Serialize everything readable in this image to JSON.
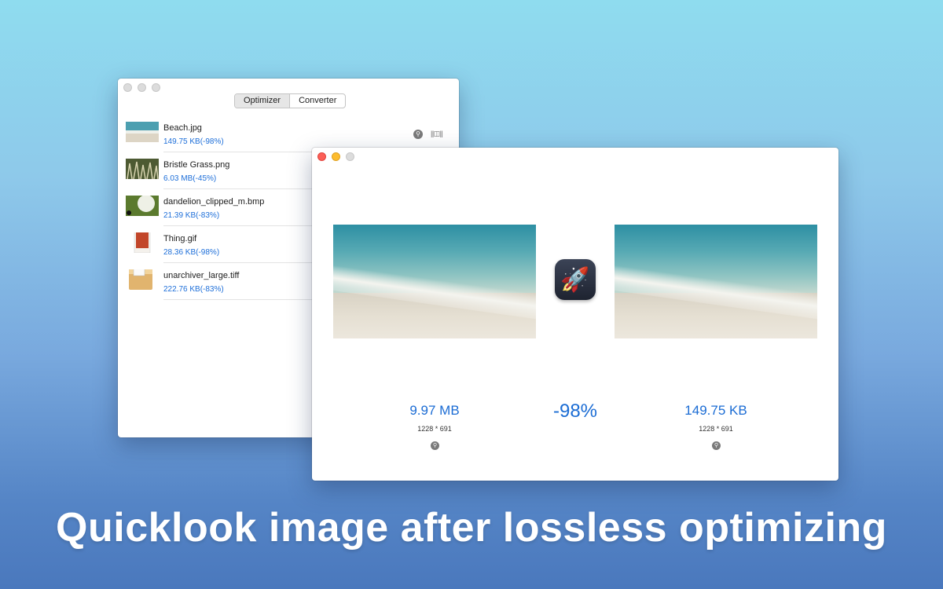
{
  "segmented": {
    "tabs": [
      "Optimizer",
      "Converter"
    ],
    "active": "Optimizer"
  },
  "files": [
    {
      "name": "Beach.jpg",
      "size": "149.75 KB(-98%)",
      "thumb": "beach"
    },
    {
      "name": "Bristle Grass.png",
      "size": "6.03 MB(-45%)",
      "thumb": "grass"
    },
    {
      "name": "dandelion_clipped_m.bmp",
      "size": "21.39 KB(-83%)",
      "thumb": "dandelion"
    },
    {
      "name": "Thing.gif",
      "size": "28.36 KB(-98%)",
      "thumb": "thing"
    },
    {
      "name": "unarchiver_large.tiff",
      "size": "222.76 KB(-83%)",
      "thumb": "box"
    }
  ],
  "list_icons": {
    "quicklook": "magnifier-icon",
    "compare": "compare-icon"
  },
  "compare_label": "||◫||",
  "quicklook": {
    "original": {
      "size": "9.97 MB",
      "dims": "1228 * 691"
    },
    "optimized": {
      "size": "149.75 KB",
      "dims": "1228 * 691"
    },
    "reduction": "-98%",
    "app_icon": "rocket-icon"
  },
  "caption": "Quicklook image after lossless optimizing",
  "colors": {
    "accent": "#1b6cd4",
    "caption": "#ffffff"
  }
}
